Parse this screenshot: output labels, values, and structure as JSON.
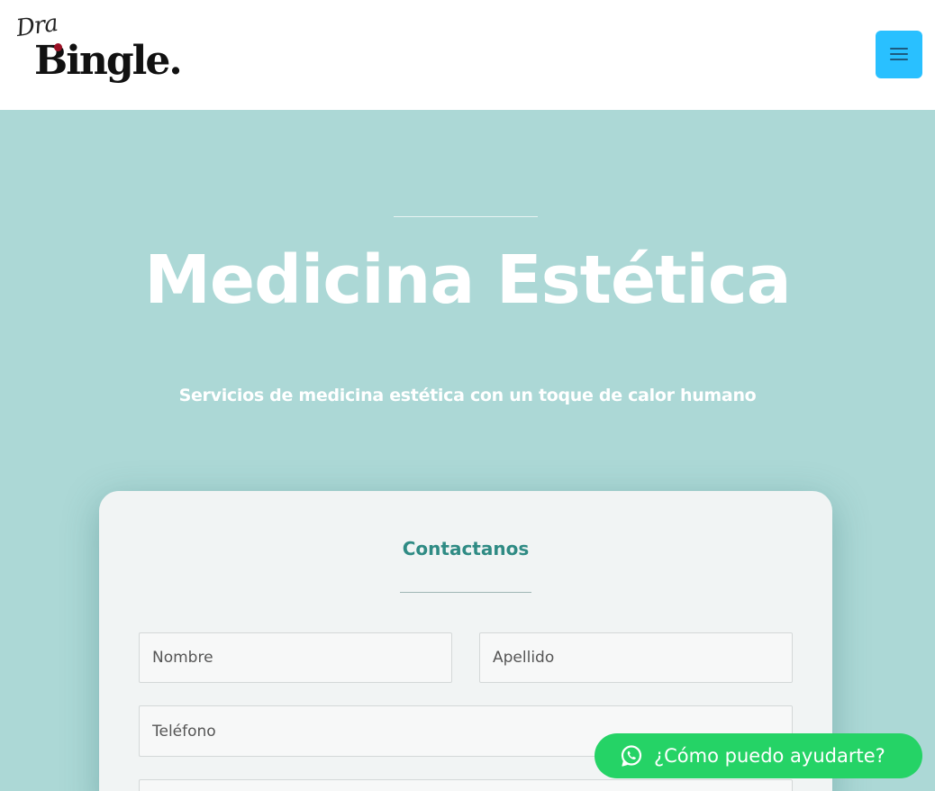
{
  "header": {
    "logo_script": "Dra",
    "logo_brand": "Bingle.",
    "menu_icon": "hamburger-icon"
  },
  "hero": {
    "title": "Medicina Estética",
    "subtitle": "Servicios de medicina estética con un toque de calor humano"
  },
  "contact": {
    "title": "Contactanos",
    "fields": {
      "nombre_placeholder": "Nombre",
      "apellido_placeholder": "Apellido",
      "telefono_placeholder": "Teléfono",
      "email_placeholder": ""
    }
  },
  "whatsapp": {
    "label": "¿Cómo puedo ayudarte?",
    "icon": "whatsapp-icon"
  },
  "colors": {
    "hero_bg": "#acd8d6",
    "menu_button": "#29c0ff",
    "accent_text": "#2f8b84",
    "whatsapp": "#25d366"
  }
}
